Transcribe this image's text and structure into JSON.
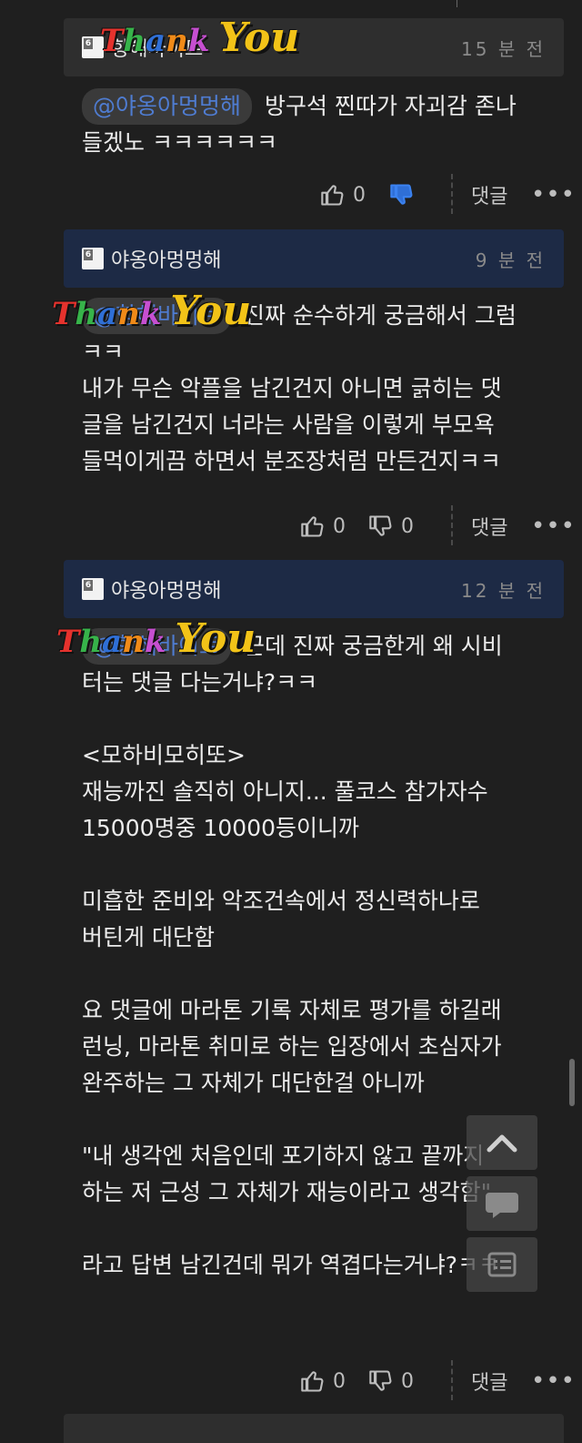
{
  "comments": [
    {
      "nickname": "항해바이트",
      "level": "6",
      "time": "15 분 전",
      "mention": "@야옹아멍멍해",
      "lines": [
        "방구석 찐따가 자괴감 존나",
        "들겠노 ㅋㅋㅋㅋㅋㅋ"
      ],
      "likes": "0",
      "dislikes": "",
      "reply_label": "댓글",
      "more_label": "•••",
      "sticker": "Thank You"
    },
    {
      "nickname": "야옹아멍멍해",
      "level": "6",
      "time": "9 분 전",
      "mention": "@항해바이트",
      "lines": [
        "진짜 순수하게 궁금해서 그럼",
        "ㅋㅋ",
        "내가 무슨 악플을 남긴건지 아니면 긁히는 댓",
        "글을 남긴건지 너라는 사람을 이렇게 부모욕",
        "들먹이게끔 하면서 분조장처럼 만든건지ㅋㅋ"
      ],
      "likes": "0",
      "dislikes": "0",
      "reply_label": "댓글",
      "more_label": "•••",
      "sticker": "Thank You"
    },
    {
      "nickname": "야옹아멍멍해",
      "level": "6",
      "time": "12 분 전",
      "mention": "@항해바이트",
      "lines": [
        "근데 진짜 궁금한게 왜 시비",
        "터는 댓글 다는거냐?ㅋㅋ",
        "",
        "<모하비모히또>",
        "재능까진 솔직히 아니지... 풀코스 참가자수",
        "15000명중 10000등이니까",
        "",
        "미흡한 준비와 악조건속에서 정신력하나로",
        "버틴게 대단함",
        "",
        "요 댓글에 마라톤 기록 자체로 평가를 하길래",
        "런닝, 마라톤 취미로 하는 입장에서 초심자가",
        "완주하는 그 자체가 대단한걸 아니까",
        "",
        "\"내 생각엔 처음인데 포기하지 않고 끝까지",
        "하는 저 근성 그 자체가 재능이라고 생각함\"",
        "",
        "라고 답변 남긴건데 뭐가 역겹다는거냐?ㅋㅋ"
      ],
      "likes": "0",
      "dislikes": "0",
      "reply_label": "댓글",
      "more_label": "•••",
      "sticker": "Thank You"
    }
  ],
  "floating": {
    "up_icon": "chevron-up-icon",
    "chat_icon": "chat-bubble-icon",
    "list_icon": "list-icon"
  }
}
